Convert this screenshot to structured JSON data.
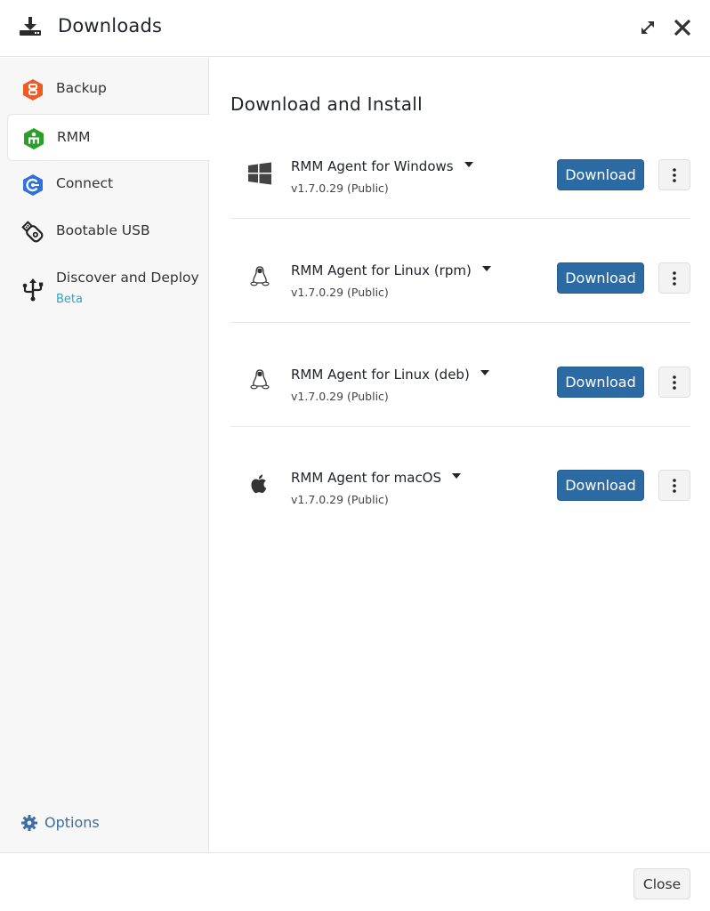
{
  "header": {
    "title": "Downloads",
    "icon": "download-icon",
    "expand_icon": "expand-icon",
    "close_icon": "close-icon"
  },
  "sidebar": {
    "items": [
      {
        "label": "Backup",
        "icon": "backup-icon",
        "color": "#f15a22",
        "active": false
      },
      {
        "label": "RMM",
        "icon": "rmm-icon",
        "color": "#2aa02a",
        "active": true
      },
      {
        "label": "Connect",
        "icon": "connect-icon",
        "color": "#2f6fe0",
        "active": false
      },
      {
        "label": "Bootable USB",
        "icon": "usb-drive-icon",
        "active": false
      },
      {
        "label": "Discover and Deploy",
        "sublabel": "Beta",
        "icon": "usb-symbol-icon",
        "active": false
      }
    ],
    "options_label": "Options",
    "options_icon": "gear-icon"
  },
  "main": {
    "heading": "Download and Install",
    "agents": [
      {
        "name": "RMM Agent for Windows",
        "version": "v1.7.0.29 (Public)",
        "os_icon": "windows-icon",
        "button": "Download"
      },
      {
        "name": "RMM Agent for Linux (rpm)",
        "version": "v1.7.0.29 (Public)",
        "os_icon": "linux-icon",
        "button": "Download"
      },
      {
        "name": "RMM Agent for Linux (deb)",
        "version": "v1.7.0.29 (Public)",
        "os_icon": "linux-icon",
        "button": "Download"
      },
      {
        "name": "RMM Agent for macOS",
        "version": "v1.7.0.29 (Public)",
        "os_icon": "apple-icon",
        "button": "Download"
      }
    ]
  },
  "footer": {
    "close_label": "Close"
  },
  "colors": {
    "primary": "#2b6aa3",
    "beta": "#2aa6c4",
    "options_link": "#3a6ea5"
  }
}
